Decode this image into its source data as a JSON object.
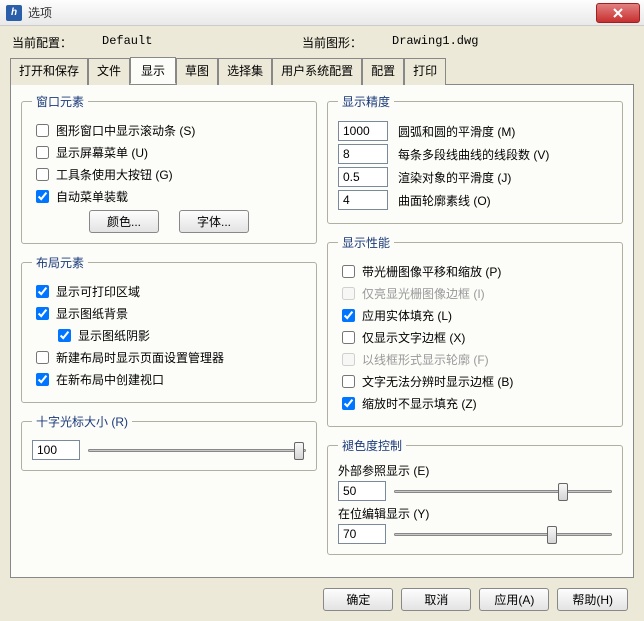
{
  "window": {
    "title": "选项",
    "close_icon": "×"
  },
  "config": {
    "current_profile_label": "当前配置：",
    "current_profile_value": "Default",
    "current_drawing_label": "当前图形：",
    "current_drawing_value": "Drawing1.dwg"
  },
  "tabs": [
    "打开和保存",
    "文件",
    "显示",
    "草图",
    "选择集",
    "用户系统配置",
    "配置",
    "打印"
  ],
  "active_tab": "显示",
  "left": {
    "window_elements": {
      "legend": "窗口元素",
      "scrollbars": "图形窗口中显示滚动条 (S)",
      "screen_menu": "显示屏幕菜单 (U)",
      "large_buttons": "工具条使用大按钮 (G)",
      "auto_menu": "自动菜单装载",
      "color_btn": "颜色...",
      "font_btn": "字体..."
    },
    "layout_elements": {
      "legend": "布局元素",
      "printable": "显示可打印区域",
      "paper_bg": "显示图纸背景",
      "paper_shadow": "显示图纸阴影",
      "page_setup": "新建布局时显示页面设置管理器",
      "viewport": "在新布局中创建视口"
    },
    "crosshair": {
      "legend": "十字光标大小 (R)",
      "value": "100"
    }
  },
  "right": {
    "precision": {
      "legend": "显示精度",
      "arc_value": "1000",
      "arc_label": "圆弧和圆的平滑度 (M)",
      "poly_value": "8",
      "poly_label": "每条多段线曲线的线段数 (V)",
      "render_value": "0.5",
      "render_label": "渲染对象的平滑度 (J)",
      "surface_value": "4",
      "surface_label": "曲面轮廓素线 (O)"
    },
    "performance": {
      "legend": "显示性能",
      "raster_pan": "带光栅图像平移和缩放 (P)",
      "raster_frame": "仅亮显光栅图像边框 (I)",
      "solid_fill": "应用实体填充 (L)",
      "text_frame": "仅显示文字边框 (X)",
      "wire_silhouette": "以线框形式显示轮廓 (F)",
      "text_unreadable": "文字无法分辨时显示边框 (B)",
      "zoom_nofill": "缩放时不显示填充 (Z)"
    },
    "fade": {
      "legend": "褪色度控制",
      "xref_label": "外部参照显示 (E)",
      "xref_value": "50",
      "inplace_label": "在位编辑显示 (Y)",
      "inplace_value": "70"
    }
  },
  "footer": {
    "ok": "确定",
    "cancel": "取消",
    "apply": "应用(A)",
    "help": "帮助(H)"
  }
}
